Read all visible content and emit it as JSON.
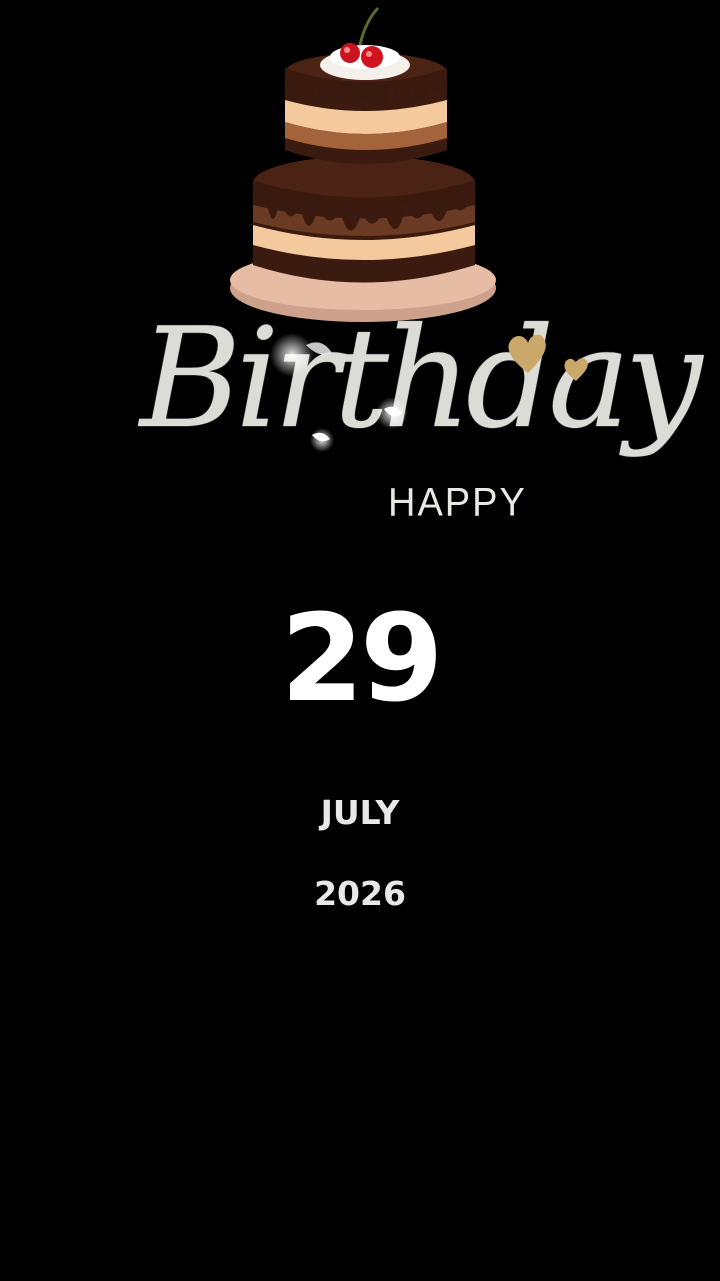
{
  "greeting": {
    "script_word": "Birthday",
    "happy_word": "HAPPY"
  },
  "date": {
    "day": "29",
    "month": "JULY",
    "year": "2026"
  },
  "decorations": {
    "cake_icon": "layered-chocolate-cake-with-cherries",
    "hearts_icon": "gold-hearts",
    "sparkle_icon": "sparkle-glow"
  },
  "colors": {
    "background": "#000000",
    "text": "#ffffff",
    "script": "#dcdcd6",
    "heart_gold": "#c9a86a",
    "chocolate": "#3b1c10",
    "cream": "#f0c79a",
    "plate": "#e3b9a1",
    "cherry": "#d3121f"
  }
}
